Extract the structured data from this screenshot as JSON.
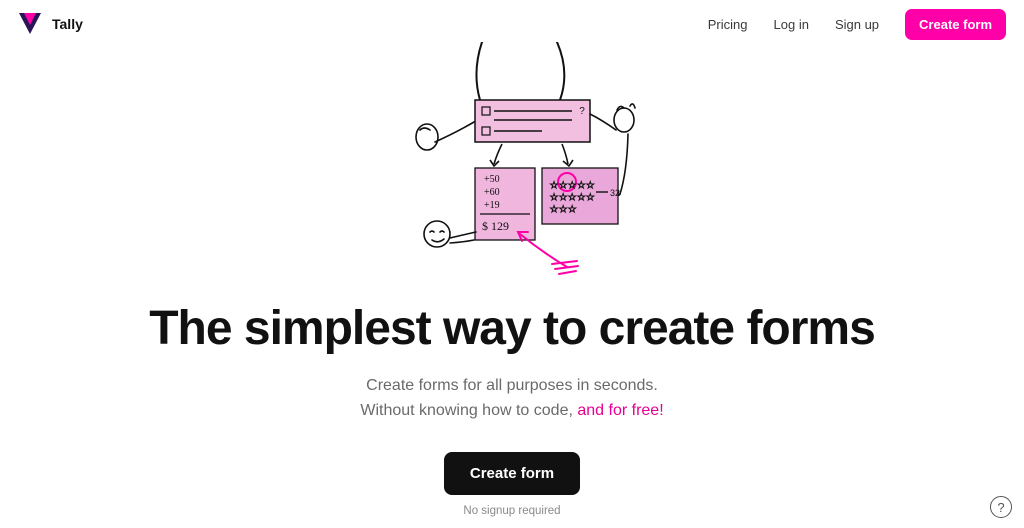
{
  "brand": {
    "name": "Tally"
  },
  "nav": {
    "pricing": "Pricing",
    "login": "Log in",
    "signup": "Sign up",
    "create_form": "Create form"
  },
  "hero": {
    "headline": "The simplest way to create forms",
    "sub_line1": "Create forms for all purposes in seconds.",
    "sub_line2_prefix": "Without knowing how to code, ",
    "sub_line2_accent": "and for free!",
    "cta_label": "Create form",
    "cta_note": "No signup required"
  },
  "illustration": {
    "calc_lines": [
      "+50",
      "+60",
      "+19"
    ],
    "calc_total": "$ 129",
    "star_label": "32"
  },
  "help": {
    "glyph": "?"
  },
  "colors": {
    "accent": "#ff00a8",
    "ink": "#111111"
  }
}
